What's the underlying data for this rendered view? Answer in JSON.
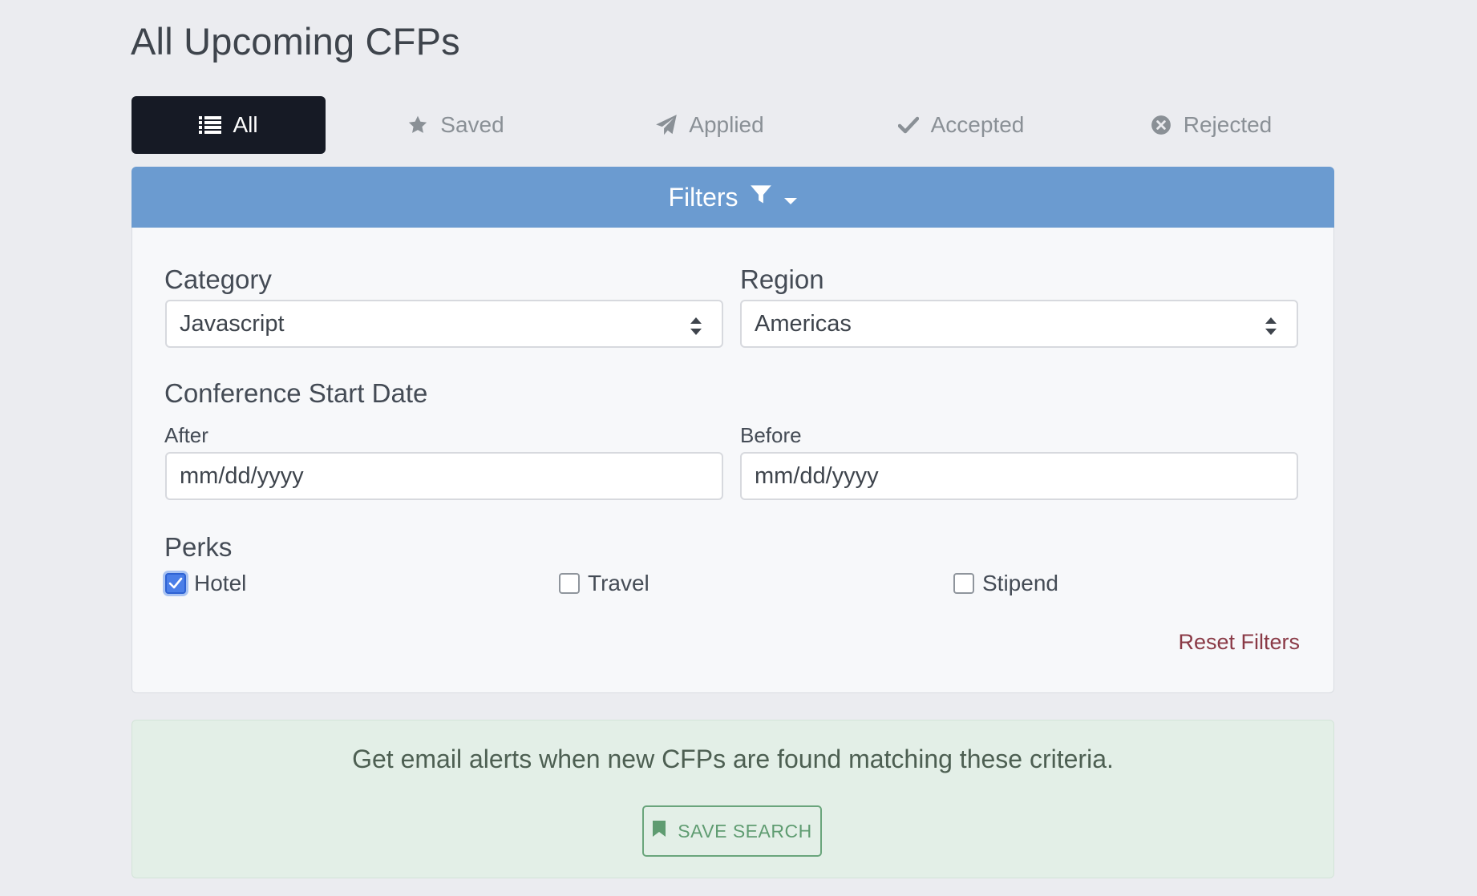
{
  "page": {
    "title": "All Upcoming CFPs"
  },
  "tabs": [
    {
      "label": "All",
      "icon": "list-icon",
      "active": true
    },
    {
      "label": "Saved",
      "icon": "star-icon",
      "active": false
    },
    {
      "label": "Applied",
      "icon": "paper-plane-icon",
      "active": false
    },
    {
      "label": "Accepted",
      "icon": "check-icon",
      "active": false
    },
    {
      "label": "Rejected",
      "icon": "x-circle-icon",
      "active": false
    }
  ],
  "filters": {
    "header_label": "Filters",
    "category": {
      "label": "Category",
      "value": "Javascript"
    },
    "region": {
      "label": "Region",
      "value": "Americas"
    },
    "start_date": {
      "label": "Conference Start Date",
      "after_label": "After",
      "after_placeholder": "mm/dd/yyyy",
      "before_label": "Before",
      "before_placeholder": "mm/dd/yyyy"
    },
    "perks": {
      "label": "Perks",
      "options": [
        {
          "label": "Hotel",
          "checked": true
        },
        {
          "label": "Travel",
          "checked": false
        },
        {
          "label": "Stipend",
          "checked": false
        }
      ]
    },
    "reset_label": "Reset Filters"
  },
  "alert": {
    "text": "Get email alerts when new CFPs are found matching these criteria.",
    "button_label": "SAVE SEARCH"
  },
  "colors": {
    "filters_bar": "#6b9bd0",
    "active_tab": "#161a25",
    "alert_bg": "#e3efe7",
    "reset_link": "#8a3a46",
    "checkbox_checked": "#4a7ee8"
  }
}
